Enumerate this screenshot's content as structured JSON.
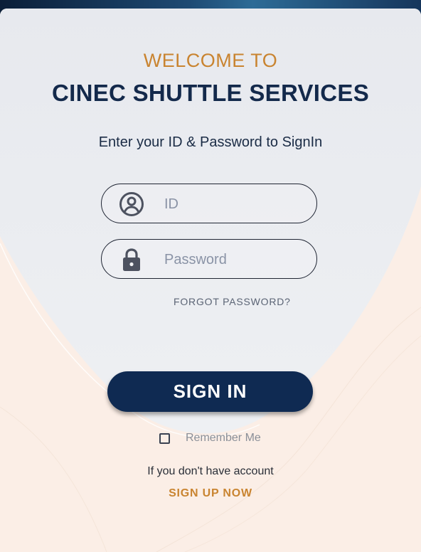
{
  "header": {
    "welcome": "WELCOME TO",
    "title": "CINEC SHUTTLE SERVICES",
    "subtitle": "Enter your ID & Password to SignIn"
  },
  "form": {
    "id_placeholder": "ID",
    "id_value": "",
    "password_placeholder": "Password",
    "password_value": "",
    "forgot_label": "FORGOT PASSWORD?",
    "signin_label": "SIGN IN",
    "remember_label": "Remember Me",
    "remember_checked": false
  },
  "footer": {
    "no_account_text": "If you don't have account",
    "signup_label": "SIGN UP NOW"
  },
  "icons": {
    "id_field": "user-circle-icon",
    "password_field": "lock-icon"
  },
  "colors": {
    "accent_orange": "#c98430",
    "navy": "#13294b",
    "button": "#0f2a52",
    "panel": "#e9ebef",
    "background": "#fbeee6"
  }
}
